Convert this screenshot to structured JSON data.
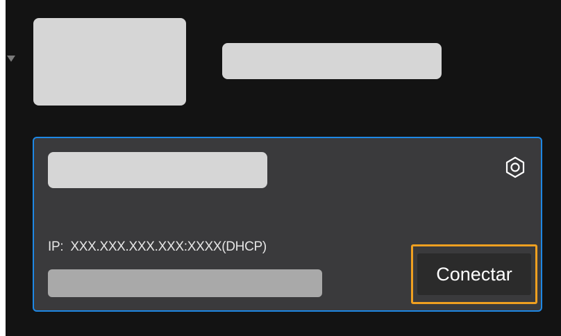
{
  "device_card": {
    "ip_label": "IP:",
    "ip_value": "XXX.XXX.XXX.XXX:XXXX(DHCP)",
    "connect_label": "Conectar",
    "settings_icon": "settings-icon"
  },
  "colors": {
    "panel_background": "#131313",
    "card_background": "#3a3a3c",
    "card_border": "#1e88e5",
    "highlight": "#f0a020",
    "placeholder": "#d6d6d6"
  }
}
